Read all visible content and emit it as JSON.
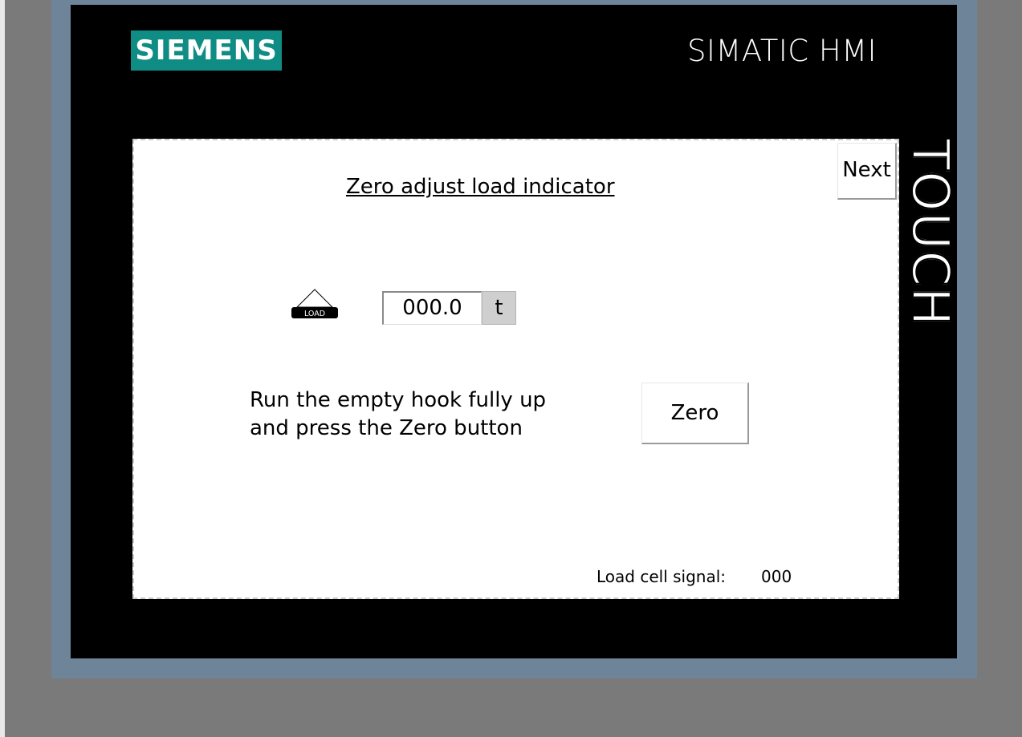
{
  "device": {
    "brand": "SIEMENS",
    "product": "SIMATIC HMI",
    "touch_label": "TOUCH"
  },
  "screen": {
    "title": "Zero adjust load indicator",
    "next_label": "Next",
    "load_icon_text": "LOAD",
    "load_value": "000.0",
    "load_unit": "t",
    "instruction_line1": "Run the empty hook fully up",
    "instruction_line2": "and press the Zero button",
    "zero_label": "Zero",
    "signal_label": "Load cell signal:",
    "signal_value": "000"
  },
  "colors": {
    "brand_teal": "#0f8c84",
    "frame_blue_gray": "#6e8498",
    "bezel": "#000000",
    "unit_bg": "#cfcfcf"
  },
  "icons": [
    "load-weight-icon"
  ]
}
